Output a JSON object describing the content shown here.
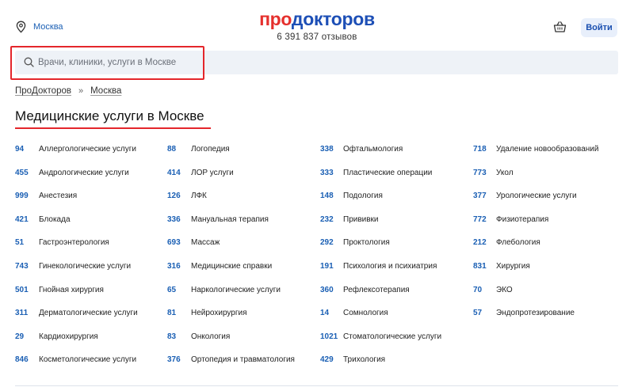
{
  "header": {
    "city": "Москва",
    "logo_part1": "про",
    "logo_part2": "докторов",
    "reviews": "6 391 837 отзывов",
    "login_label": "Войти"
  },
  "search": {
    "placeholder": "Врачи, клиники, услуги в Москве"
  },
  "breadcrumb": {
    "items": [
      "ПроДокторов",
      "Москва"
    ],
    "separator": "»"
  },
  "page_title": "Медицинские услуги в Москве",
  "columns": [
    [
      {
        "count": "94",
        "name": "Аллергологические услуги"
      },
      {
        "count": "455",
        "name": "Андрологические услуги"
      },
      {
        "count": "999",
        "name": "Анестезия"
      },
      {
        "count": "421",
        "name": "Блокада"
      },
      {
        "count": "51",
        "name": "Гастроэнтерология"
      },
      {
        "count": "743",
        "name": "Гинекологические услуги"
      },
      {
        "count": "501",
        "name": "Гнойная хирургия"
      },
      {
        "count": "311",
        "name": "Дерматологические услуги"
      },
      {
        "count": "29",
        "name": "Кардиохирургия"
      },
      {
        "count": "846",
        "name": "Косметологические услуги"
      }
    ],
    [
      {
        "count": "88",
        "name": "Логопедия"
      },
      {
        "count": "414",
        "name": "ЛОР услуги"
      },
      {
        "count": "126",
        "name": "ЛФК"
      },
      {
        "count": "336",
        "name": "Мануальная терапия"
      },
      {
        "count": "693",
        "name": "Массаж"
      },
      {
        "count": "316",
        "name": "Медицинские справки"
      },
      {
        "count": "65",
        "name": "Наркологические услуги"
      },
      {
        "count": "81",
        "name": "Нейрохирургия"
      },
      {
        "count": "83",
        "name": "Онкология"
      },
      {
        "count": "376",
        "name": "Ортопедия и травматология"
      }
    ],
    [
      {
        "count": "338",
        "name": "Офтальмология"
      },
      {
        "count": "333",
        "name": "Пластические операции"
      },
      {
        "count": "148",
        "name": "Подология"
      },
      {
        "count": "232",
        "name": "Прививки"
      },
      {
        "count": "292",
        "name": "Проктология"
      },
      {
        "count": "191",
        "name": "Психология и психиатрия"
      },
      {
        "count": "360",
        "name": "Рефлексотерапия"
      },
      {
        "count": "14",
        "name": "Сомнология"
      },
      {
        "count": "1021",
        "name": "Стоматологические услуги"
      },
      {
        "count": "429",
        "name": "Трихология"
      }
    ],
    [
      {
        "count": "718",
        "name": "Удаление новообразований"
      },
      {
        "count": "773",
        "name": "Укол"
      },
      {
        "count": "377",
        "name": "Урологические услуги"
      },
      {
        "count": "772",
        "name": "Физиотерапия"
      },
      {
        "count": "212",
        "name": "Флебология"
      },
      {
        "count": "831",
        "name": "Хирургия"
      },
      {
        "count": "70",
        "name": "ЭКО"
      },
      {
        "count": "57",
        "name": "Эндопротезирование"
      }
    ]
  ],
  "icons": {
    "location": "location-pin-icon",
    "cart": "basket-icon",
    "search": "search-icon"
  },
  "colors": {
    "brand_red": "#e5302d",
    "brand_blue": "#1d4fb6",
    "link_blue": "#1a5fb4",
    "highlight_red": "#e4262b"
  }
}
